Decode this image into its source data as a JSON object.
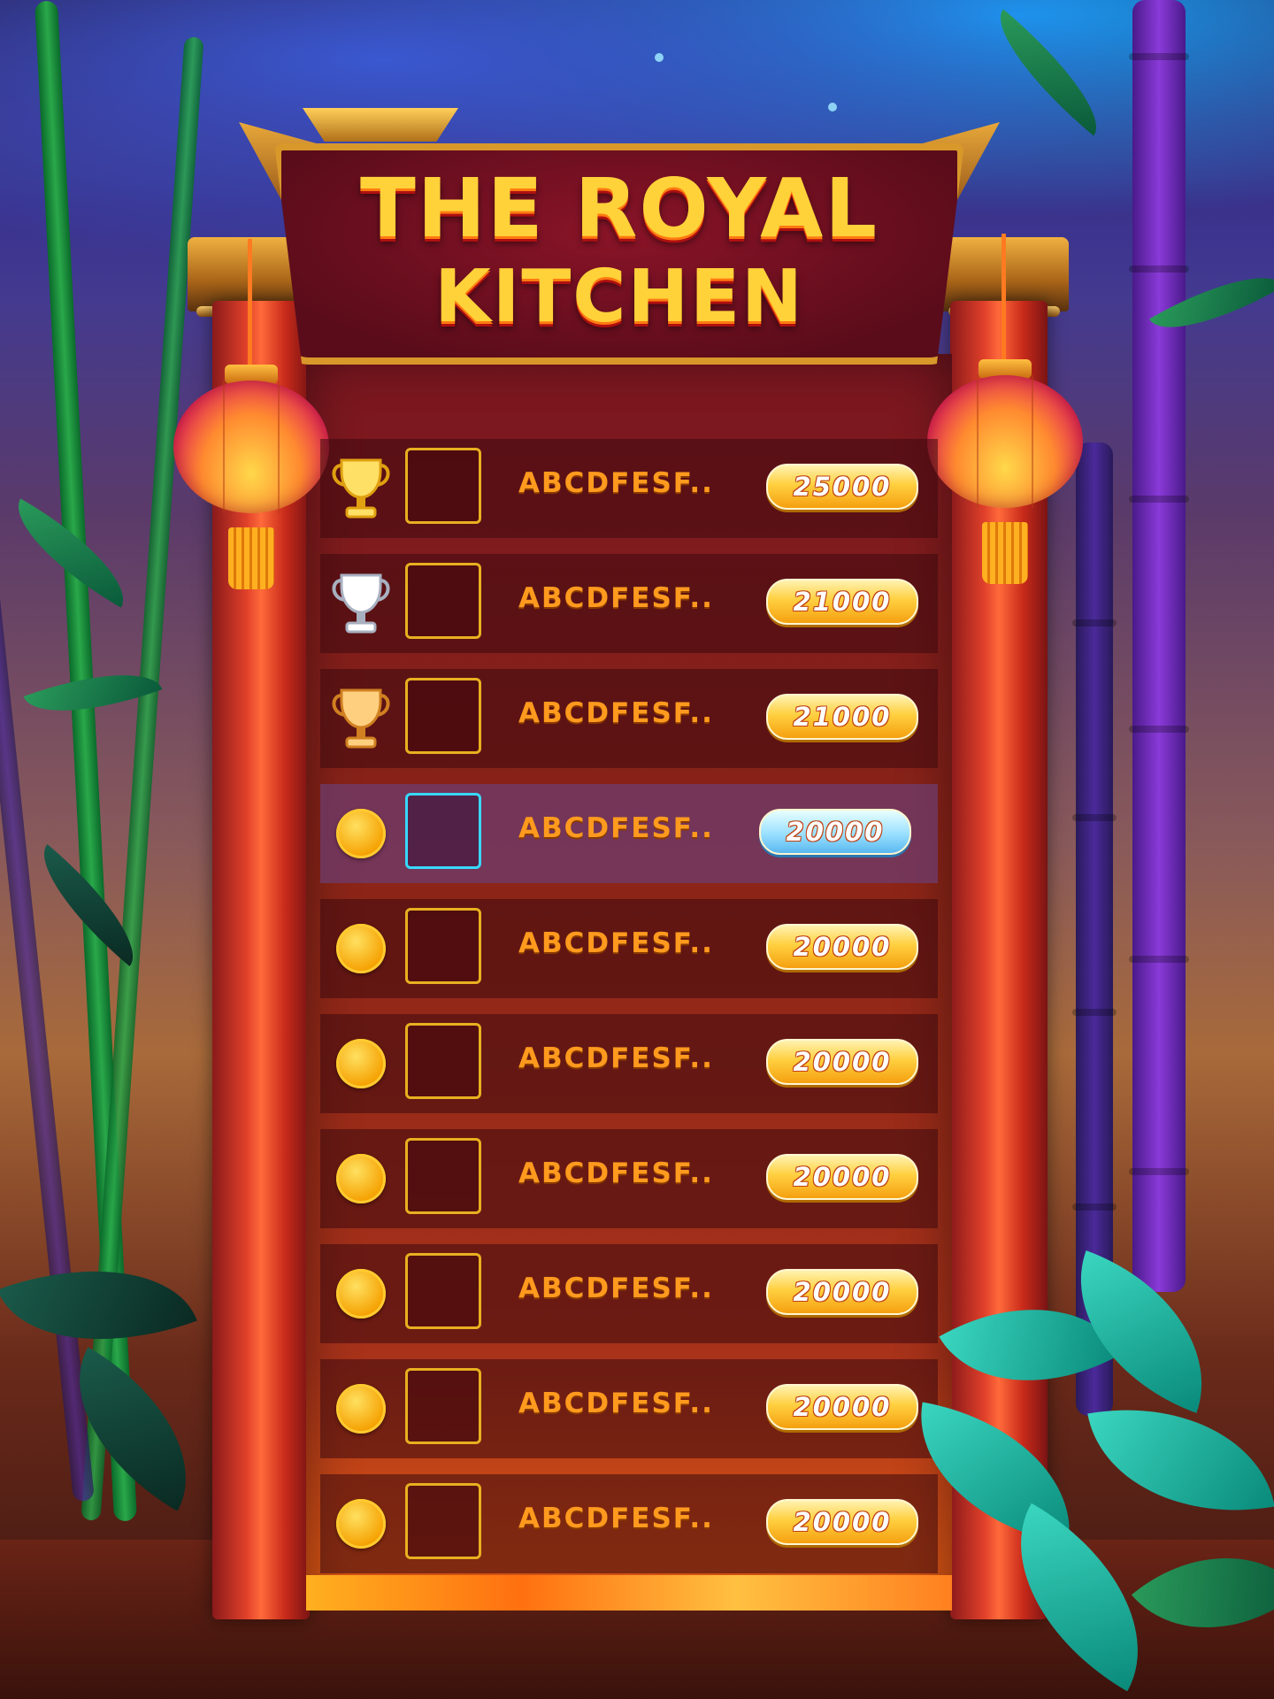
{
  "title": {
    "line1": "THE ROYAL",
    "line2": "KITCHEN"
  },
  "leaderboard": [
    {
      "rank_icon": "gold-trophy-icon",
      "name": "ABCDFESF..",
      "score": "25000",
      "highlighted": false
    },
    {
      "rank_icon": "silver-trophy-icon",
      "name": "ABCDFESF..",
      "score": "21000",
      "highlighted": false
    },
    {
      "rank_icon": "bronze-trophy-icon",
      "name": "ABCDFESF..",
      "score": "21000",
      "highlighted": false
    },
    {
      "rank_icon": "coin-icon",
      "name": "ABCDFESF..",
      "score": "20000",
      "highlighted": true
    },
    {
      "rank_icon": "coin-icon",
      "name": "ABCDFESF..",
      "score": "20000",
      "highlighted": false
    },
    {
      "rank_icon": "coin-icon",
      "name": "ABCDFESF..",
      "score": "20000",
      "highlighted": false
    },
    {
      "rank_icon": "coin-icon",
      "name": "ABCDFESF..",
      "score": "20000",
      "highlighted": false
    },
    {
      "rank_icon": "coin-icon",
      "name": "ABCDFESF..",
      "score": "20000",
      "highlighted": false
    },
    {
      "rank_icon": "coin-icon",
      "name": "ABCDFESF..",
      "score": "20000",
      "highlighted": false
    },
    {
      "rank_icon": "coin-icon",
      "name": "ABCDFESF..",
      "score": "20000",
      "highlighted": false
    }
  ],
  "colors": {
    "gold": "#ffd23a",
    "name_text": "#ff9a1e",
    "highlight_row": "#6e3c6e",
    "highlight_border": "#38d8ff"
  }
}
